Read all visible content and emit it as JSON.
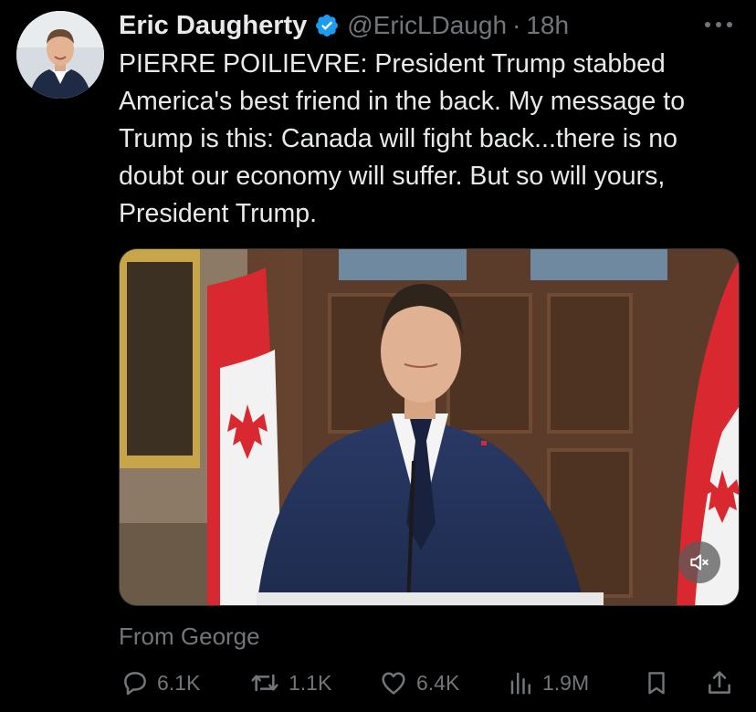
{
  "tweet": {
    "author_name": "Eric Daugherty",
    "handle": "@EricLDaugh",
    "separator": "·",
    "time": "18h",
    "text": "PIERRE POILIEVRE: President Trump stabbed America's best friend in the back. My message to Trump is this: Canada will fight back...there is no doubt our economy will suffer. But so will yours, President Trump.",
    "from_label": "From George"
  },
  "icons": {
    "verified": "verified-badge-icon",
    "more": "more-options-icon",
    "mute": "volume-muted-icon",
    "reply": "reply-icon",
    "repost": "repost-icon",
    "like": "like-icon",
    "views": "views-icon",
    "bookmark": "bookmark-icon",
    "share": "share-icon"
  },
  "stats": {
    "replies": "6.1K",
    "reposts": "1.1K",
    "likes": "6.4K",
    "views": "1.9M"
  },
  "colors": {
    "background": "#000000",
    "text": "#e7e9ea",
    "secondary_text": "#71767b",
    "verified": "#1d9bf0"
  }
}
